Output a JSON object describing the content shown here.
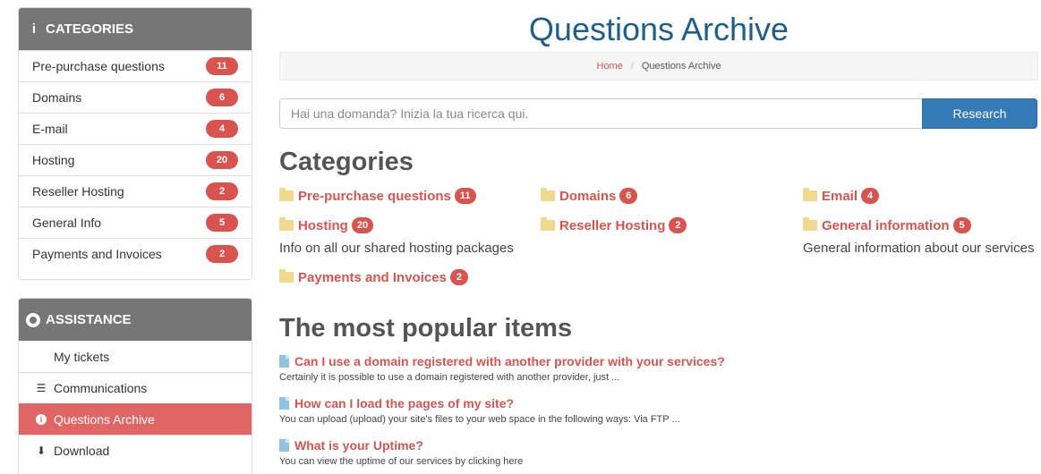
{
  "sidebar": {
    "categories": {
      "heading": "CATEGORIES",
      "items": [
        {
          "label": "Pre-purchase questions",
          "count": "11"
        },
        {
          "label": "Domains",
          "count": "6"
        },
        {
          "label": "E-mail",
          "count": "4"
        },
        {
          "label": "Hosting",
          "count": "20"
        },
        {
          "label": "Reseller Hosting",
          "count": "2"
        },
        {
          "label": "General Info",
          "count": "5"
        },
        {
          "label": "Payments and Invoices",
          "count": "2"
        }
      ]
    },
    "assistance": {
      "heading": "ASSISTANCE",
      "items": [
        {
          "label": "My tickets",
          "icon": "none"
        },
        {
          "label": "Communications",
          "icon": "list-icon"
        },
        {
          "label": "Questions Archive",
          "icon": "info-icon"
        },
        {
          "label": "Download",
          "icon": "download-icon"
        }
      ]
    }
  },
  "main": {
    "title": "Questions Archive",
    "breadcrumb": {
      "home": "Home",
      "current": "Questions Archive"
    },
    "search": {
      "placeholder": "Hai una domanda? Inizia la tua ricerca qui.",
      "button": "Research"
    },
    "categories_heading": "Categories",
    "categories": [
      {
        "label": "Pre-purchase questions",
        "count": "11",
        "desc": ""
      },
      {
        "label": "Domains",
        "count": "6",
        "desc": ""
      },
      {
        "label": "Email",
        "count": "4",
        "desc": ""
      },
      {
        "label": "Hosting",
        "count": "20",
        "desc": "Info on all our shared hosting packages"
      },
      {
        "label": "Reseller Hosting",
        "count": "2",
        "desc": ""
      },
      {
        "label": "General information",
        "count": "5",
        "desc": "General information about our services"
      },
      {
        "label": "Payments and Invoices",
        "count": "2",
        "desc": ""
      }
    ],
    "popular_heading": "The most popular items",
    "popular": [
      {
        "title": "Can I use a domain registered with another provider with your services?",
        "snippet": "Certainly it is possible to use a domain registered with another provider, just ..."
      },
      {
        "title": "How can I load the pages of my site?",
        "snippet": "You can upload (upload) your site's files to your web space in the following ways: Via FTP ..."
      },
      {
        "title": "What is your Uptime?",
        "snippet": "You can view the uptime of our services by clicking here"
      }
    ]
  },
  "colors": {
    "accent": "#d9534f",
    "title": "#1d5f8a",
    "button": "#337ab7",
    "panel_head": "#767676",
    "folder": "#f0d98a"
  }
}
